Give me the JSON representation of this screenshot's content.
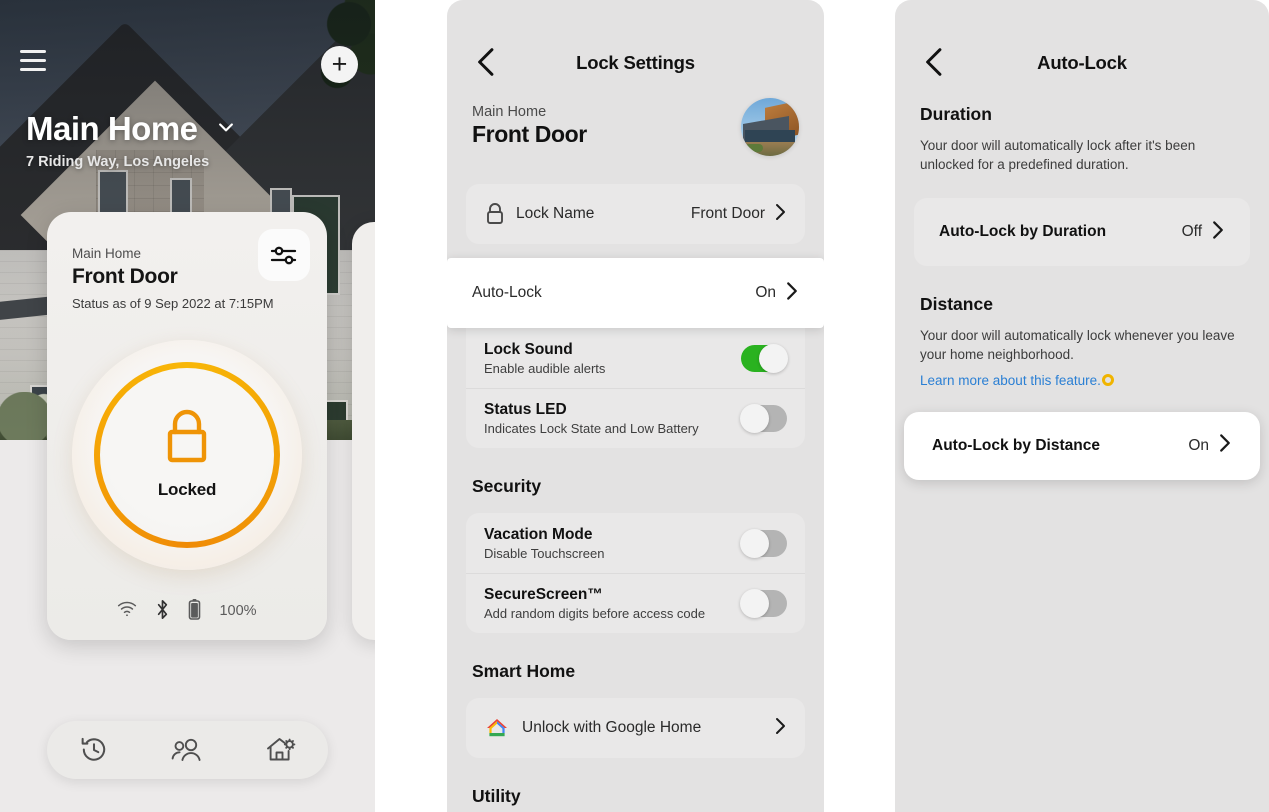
{
  "home": {
    "menu_icon": "hamburger-menu-icon",
    "add_icon": "plus-icon",
    "title": "Main Home",
    "address": "7 Riding Way, Los Angeles",
    "chevron_icon": "chevron-down-icon",
    "lock_card": {
      "home_name": "Main Home",
      "device_name": "Front Door",
      "status_line": "Status as of 9 Sep 2022 at 7:15PM",
      "settings_icon": "sliders-icon",
      "lock_state_icon": "padlock-locked-icon",
      "lock_state": "Locked",
      "ring_color_top": "#f8b707",
      "ring_color_bottom": "#ef8b06",
      "wifi_icon": "wifi-icon",
      "bluetooth_icon": "bluetooth-icon",
      "battery_icon": "battery-icon",
      "battery_level": "100%"
    },
    "bottom_nav": [
      {
        "icon": "history-clock-icon",
        "name": "activity"
      },
      {
        "icon": "people-icon",
        "name": "guests"
      },
      {
        "icon": "home-gear-icon",
        "name": "home-settings"
      }
    ]
  },
  "lock_settings": {
    "back_icon": "chevron-left-icon",
    "title": "Lock Settings",
    "home_name": "Main Home",
    "device_name": "Front Door",
    "avatar_icon": "home-photo-avatar",
    "rows": {
      "lock_name": {
        "icon": "padlock-icon",
        "label": "Lock Name",
        "value": "Front Door",
        "chevron": "chevron-right-icon"
      },
      "auto_lock": {
        "label": "Auto-Lock",
        "value": "On",
        "chevron": "chevron-right-icon",
        "highlighted": true
      },
      "lock_sound": {
        "label": "Lock Sound",
        "sub": "Enable audible alerts",
        "toggle": "on",
        "toggle_color": "#2ab220"
      },
      "status_led": {
        "label": "Status LED",
        "sub": "Indicates Lock State and Low Battery",
        "toggle": "off",
        "toggle_color": "#b4b4b4"
      }
    },
    "security": {
      "heading": "Security",
      "vacation_mode": {
        "label": "Vacation Mode",
        "sub": "Disable Touchscreen",
        "toggle": "off"
      },
      "secure_screen": {
        "label": "SecureScreen™",
        "sub": "Add random digits before access code",
        "toggle": "off"
      }
    },
    "smart_home": {
      "heading": "Smart Home",
      "google_home": {
        "icon": "google-home-icon",
        "label": "Unlock with Google Home",
        "chevron": "chevron-right-icon"
      }
    },
    "utility_heading": "Utility"
  },
  "auto_lock": {
    "back_icon": "chevron-left-icon",
    "title": "Auto-Lock",
    "duration": {
      "heading": "Duration",
      "description": "Your door will automatically lock after it's been unlocked for a predefined duration.",
      "row": {
        "label": "Auto-Lock by Duration",
        "value": "Off",
        "chevron": "chevron-right-icon"
      }
    },
    "distance": {
      "heading": "Distance",
      "description": "Your door will automatically lock whenever you leave your home neighborhood.",
      "learn_more": "Learn more about this feature.",
      "learn_more_icon": "info-ring-icon",
      "learn_more_color": "#2a7fd4",
      "ring_color": "#f0b400",
      "row": {
        "label": "Auto-Lock by Distance",
        "value": "On",
        "chevron": "chevron-right-icon",
        "highlighted": true
      }
    }
  }
}
